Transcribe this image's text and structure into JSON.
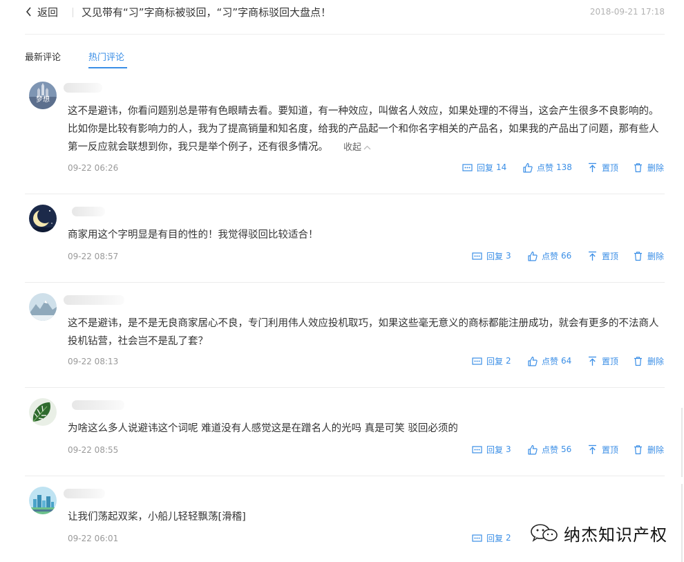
{
  "header": {
    "back_label": "返回",
    "title": "又见带有“习”字商标被驳回，“习”字商标驳回大盘点！",
    "date": "2018-09-21 17:18"
  },
  "tabs": [
    {
      "label": "最新评论",
      "active": false
    },
    {
      "label": "热门评论",
      "active": true
    }
  ],
  "actions": {
    "reply": "回复",
    "like": "点赞",
    "top": "置顶",
    "delete": "删除"
  },
  "collapse_label": "收起",
  "comments": [
    {
      "text": "这不是避讳，你看问题别总是带有色眼睛去看。要知道，有一种效应，叫做名人效应，如果处理的不得当，这会产生很多不良影响的。比如你是比较有影响力的人，我为了提高销量和知名度，给我的产品起一个和你名字相关的产品名，如果我的产品出了问题，那有些人第一反应就会联想到你，我只是举个例子，还有很多情况。",
      "time": "09-22 06:26",
      "reply_count": "14",
      "like_count": "138",
      "avatar": "dream-castle-avatar",
      "avatar_text": "梦想"
    },
    {
      "text": "商家用这个字明显是有目的性的！我觉得驳回比较适合！",
      "time": "09-22 08:57",
      "reply_count": "3",
      "like_count": "66",
      "avatar": "moon-night-avatar"
    },
    {
      "text": "这不是避讳，是不是无良商家居心不良，专门利用伟人效应投机取巧，如果这些毫无意义的商标都能注册成功，就会有更多的不法商人投机钻营，社会岂不是乱了套？",
      "time": "09-22 08:13",
      "reply_count": "2",
      "like_count": "64",
      "avatar": "snow-mountain-avatar"
    },
    {
      "text": "为啥这么多人说避讳这个词呢 难道没有人感觉这是在蹭名人的光吗 真是可笑 驳回必须的",
      "time": "09-22 08:55",
      "reply_count": "3",
      "like_count": "56",
      "avatar": "monstera-leaf-avatar"
    },
    {
      "text": "让我们荡起双桨，小船儿轻轻飘荡[滑稽]",
      "time": "09-22 06:01",
      "reply_count": "2",
      "like_count": "",
      "avatar": "city-skyline-avatar"
    }
  ],
  "watermark": "纳杰知识产权",
  "colors": {
    "accent": "#3a8ee6",
    "text": "#333333",
    "muted": "#999999",
    "date": "#b2b2b2",
    "divider": "#ececec"
  }
}
